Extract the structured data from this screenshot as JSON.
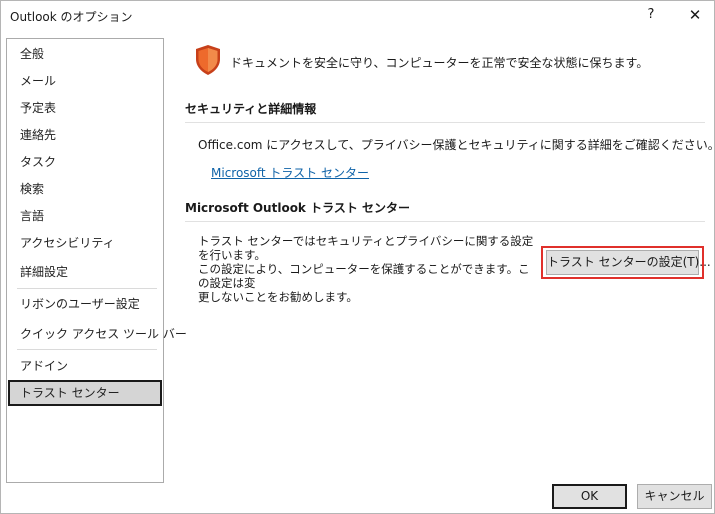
{
  "window": {
    "title": "Outlook のオプション",
    "help_label": "?",
    "close_label": "✕"
  },
  "sidebar": {
    "items": [
      {
        "label": "全般"
      },
      {
        "label": "メール"
      },
      {
        "label": "予定表"
      },
      {
        "label": "連絡先"
      },
      {
        "label": "タスク"
      },
      {
        "label": "検索"
      },
      {
        "label": "言語"
      },
      {
        "label": "アクセシビリティ"
      },
      {
        "label": "詳細設定"
      },
      {
        "label": "リボンのユーザー設定"
      },
      {
        "label": "クイック アクセス ツール バー"
      },
      {
        "label": "アドイン"
      },
      {
        "label": "トラスト センター"
      }
    ],
    "selected": "トラスト センター"
  },
  "main": {
    "header_text": "ドキュメントを安全に守り、コンピューターを正常で安全な状態に保ちます。",
    "header_icon": "shield-icon",
    "security_section": {
      "title": "セキュリティと詳細情報",
      "description": "Office.com にアクセスして、プライバシー保護とセキュリティに関する詳細をご確認ください。",
      "link_text": "Microsoft トラスト センター"
    },
    "trust_center_section": {
      "title": "Microsoft Outlook トラスト センター",
      "description_lines": [
        "トラスト センターではセキュリティとプライバシーに関する設定を行います。",
        "この設定により、コンピューターを保護することができます。この設定は変",
        "更しないことをお勧めします。"
      ],
      "button_label": "トラスト センターの設定(T)..."
    }
  },
  "footer": {
    "ok_label": "OK",
    "cancel_label": "キャンセル"
  },
  "colors": {
    "shield": "#e8531f",
    "link": "#0f63a8",
    "highlight": "#e0302b"
  }
}
